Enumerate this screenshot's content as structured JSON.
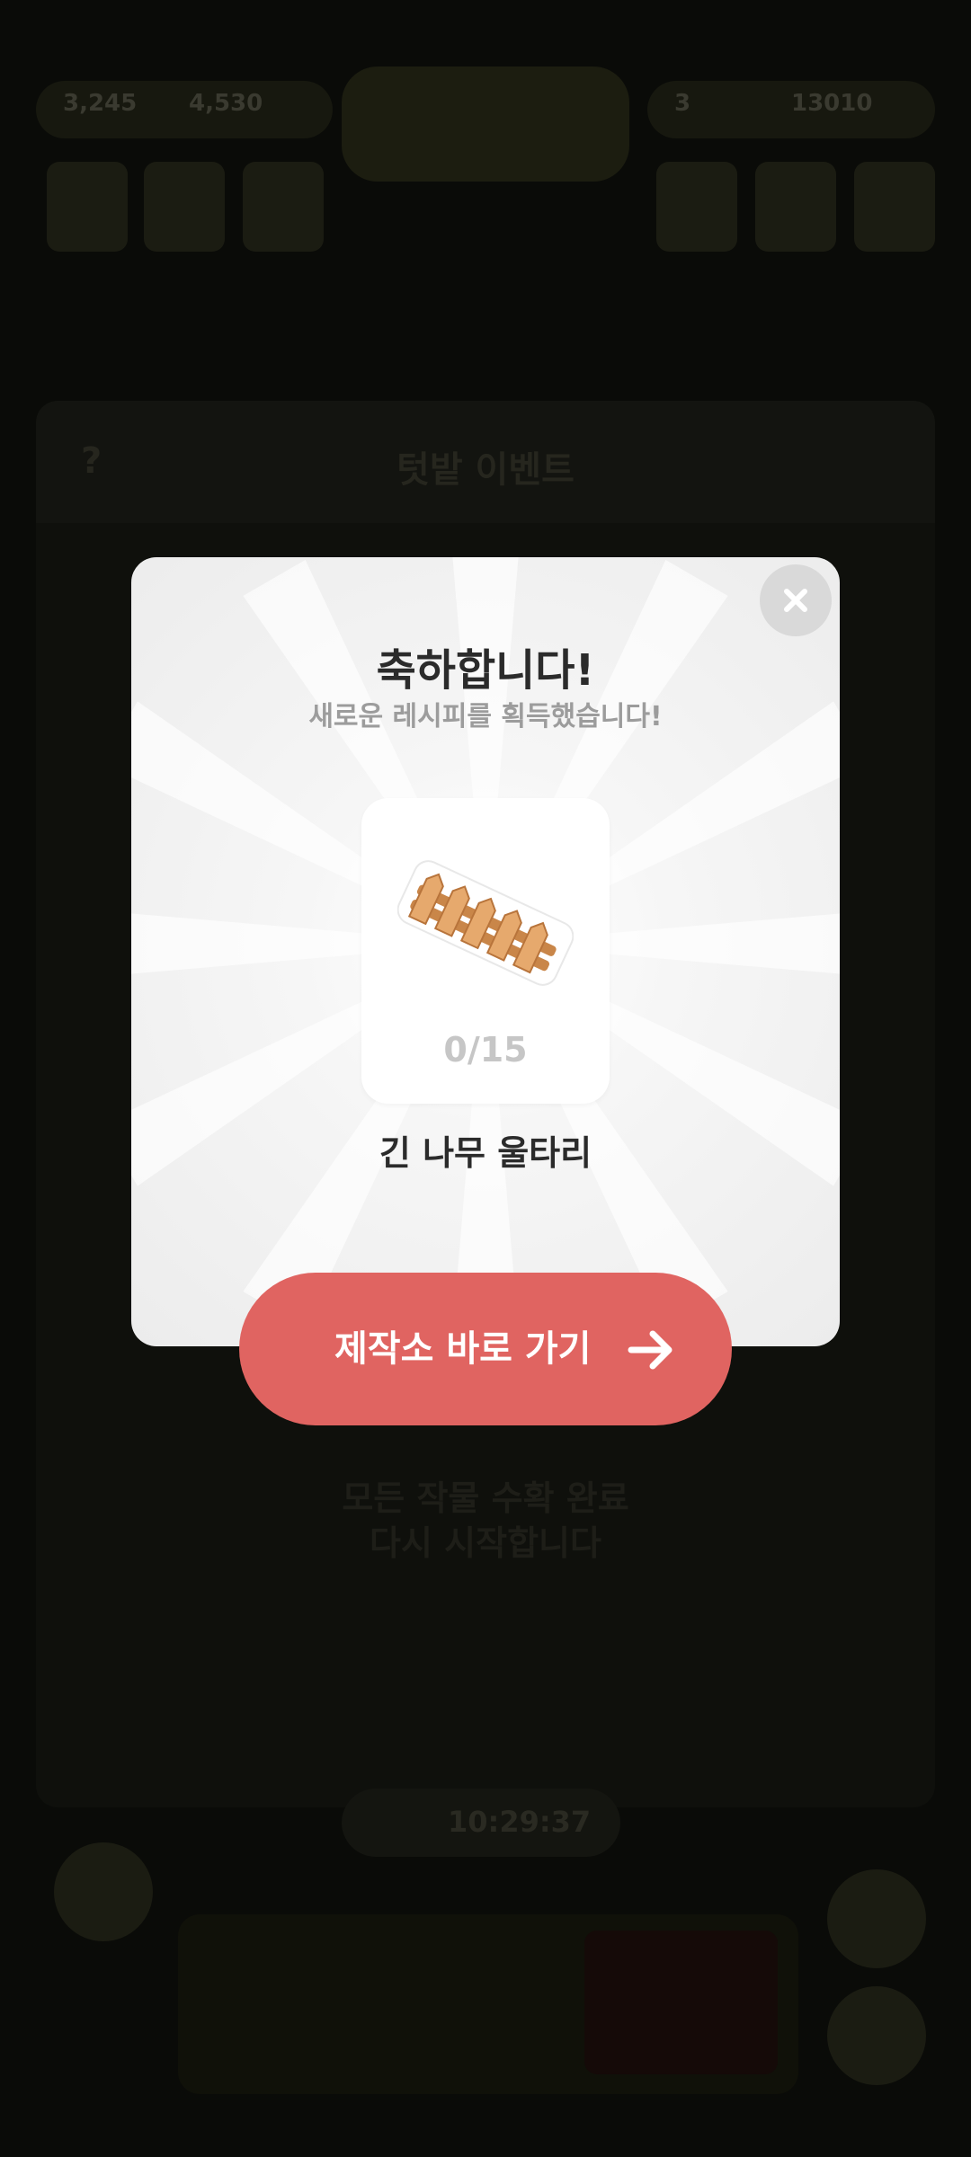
{
  "background": {
    "currency_left_1": "3,245",
    "currency_left_2": "4,530",
    "currency_right_1": "3",
    "currency_right_2": "13010",
    "panel_title": "텃밭 이벤트",
    "panel_help": "?",
    "panel_message_line1": "모든 작물 수확 완료",
    "panel_message_line2": "다시 시작합니다",
    "timer": "10:29:37"
  },
  "modal": {
    "title": "축하합니다!",
    "subtitle": "새로운 레시피를 획득했습니다!",
    "item": {
      "name": "긴 나무 울타리",
      "count": "0/15",
      "icon": "wooden-fence-icon"
    },
    "cta_label": "제작소 바로 가기",
    "close_icon": "close-icon",
    "cta_icon": "arrow-right-icon"
  },
  "colors": {
    "cta": "#e06461",
    "modal_bg": "#f2f2f2",
    "close_bg": "#d9d9d9",
    "fence": "#e0a56a"
  }
}
